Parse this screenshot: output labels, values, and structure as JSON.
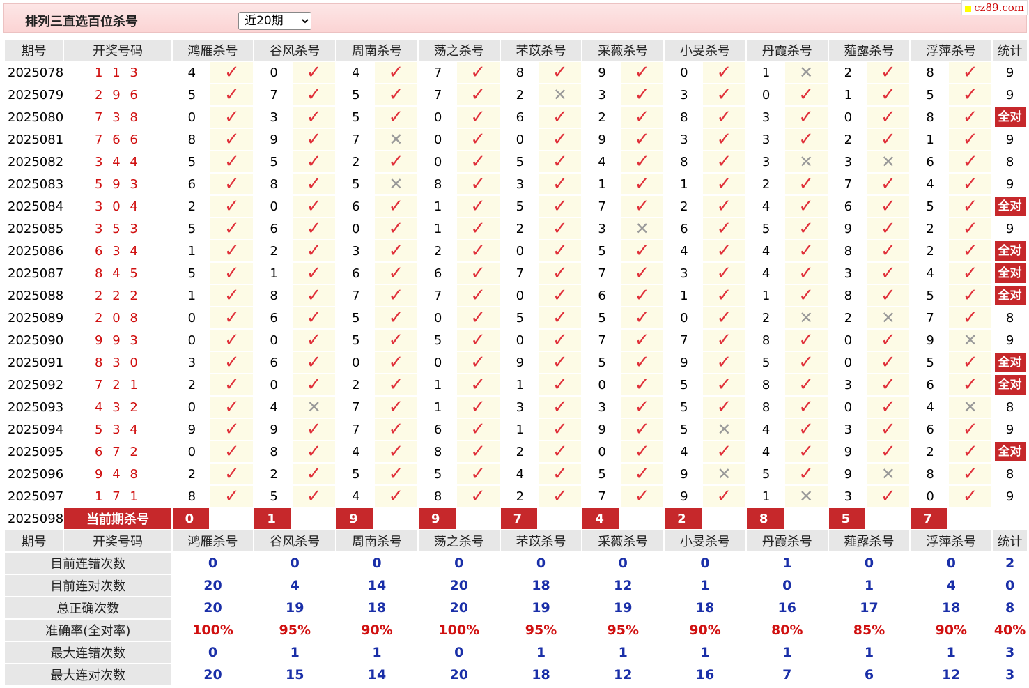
{
  "title": "排列三直选百位杀号",
  "period_select": "近20期",
  "brand": "cz89.com",
  "headers": [
    "期号",
    "开奖号码",
    "鸿雁杀号",
    "谷风杀号",
    "周南杀号",
    "荡之杀号",
    "芣苡杀号",
    "采薇杀号",
    "小旻杀号",
    "丹霞杀号",
    "薤露杀号",
    "浮萍杀号",
    "统计"
  ],
  "rows": [
    {
      "issue": "2025078",
      "win": "1 1 3",
      "kills": [
        "4",
        "0",
        "4",
        "7",
        "8",
        "9",
        "0",
        "1",
        "2",
        "8"
      ],
      "hits": [
        1,
        1,
        1,
        1,
        1,
        1,
        1,
        0,
        1,
        1
      ],
      "stat": "9"
    },
    {
      "issue": "2025079",
      "win": "2 9 6",
      "kills": [
        "5",
        "7",
        "5",
        "7",
        "2",
        "3",
        "3",
        "0",
        "1",
        "5"
      ],
      "hits": [
        1,
        1,
        1,
        1,
        0,
        1,
        1,
        1,
        1,
        1
      ],
      "stat": "9"
    },
    {
      "issue": "2025080",
      "win": "7 3 8",
      "kills": [
        "0",
        "3",
        "5",
        "0",
        "6",
        "2",
        "8",
        "3",
        "0",
        "8"
      ],
      "hits": [
        1,
        1,
        1,
        1,
        1,
        1,
        1,
        1,
        1,
        1
      ],
      "stat": "全对"
    },
    {
      "issue": "2025081",
      "win": "7 6 6",
      "kills": [
        "8",
        "9",
        "7",
        "0",
        "0",
        "9",
        "3",
        "3",
        "2",
        "1"
      ],
      "hits": [
        1,
        1,
        0,
        1,
        1,
        1,
        1,
        1,
        1,
        1
      ],
      "stat": "9"
    },
    {
      "issue": "2025082",
      "win": "3 4 4",
      "kills": [
        "5",
        "5",
        "2",
        "0",
        "5",
        "4",
        "8",
        "3",
        "3",
        "6"
      ],
      "hits": [
        1,
        1,
        1,
        1,
        1,
        1,
        1,
        0,
        0,
        1
      ],
      "stat": "8"
    },
    {
      "issue": "2025083",
      "win": "5 9 3",
      "kills": [
        "6",
        "8",
        "5",
        "8",
        "3",
        "1",
        "1",
        "2",
        "7",
        "4"
      ],
      "hits": [
        1,
        1,
        0,
        1,
        1,
        1,
        1,
        1,
        1,
        1
      ],
      "stat": "9"
    },
    {
      "issue": "2025084",
      "win": "3 0 4",
      "kills": [
        "2",
        "0",
        "6",
        "1",
        "5",
        "7",
        "2",
        "4",
        "6",
        "5"
      ],
      "hits": [
        1,
        1,
        1,
        1,
        1,
        1,
        1,
        1,
        1,
        1
      ],
      "stat": "全对"
    },
    {
      "issue": "2025085",
      "win": "3 5 3",
      "kills": [
        "5",
        "6",
        "0",
        "1",
        "2",
        "3",
        "6",
        "5",
        "9",
        "2"
      ],
      "hits": [
        1,
        1,
        1,
        1,
        1,
        0,
        1,
        1,
        1,
        1
      ],
      "stat": "9"
    },
    {
      "issue": "2025086",
      "win": "6 3 4",
      "kills": [
        "1",
        "2",
        "3",
        "2",
        "0",
        "5",
        "4",
        "4",
        "8",
        "2"
      ],
      "hits": [
        1,
        1,
        1,
        1,
        1,
        1,
        1,
        1,
        1,
        1
      ],
      "stat": "全对"
    },
    {
      "issue": "2025087",
      "win": "8 4 5",
      "kills": [
        "5",
        "1",
        "6",
        "6",
        "7",
        "7",
        "3",
        "4",
        "3",
        "4"
      ],
      "hits": [
        1,
        1,
        1,
        1,
        1,
        1,
        1,
        1,
        1,
        1
      ],
      "stat": "全对"
    },
    {
      "issue": "2025088",
      "win": "2 2 2",
      "kills": [
        "1",
        "8",
        "7",
        "7",
        "0",
        "6",
        "1",
        "1",
        "8",
        "5"
      ],
      "hits": [
        1,
        1,
        1,
        1,
        1,
        1,
        1,
        1,
        1,
        1
      ],
      "stat": "全对"
    },
    {
      "issue": "2025089",
      "win": "2 0 8",
      "kills": [
        "0",
        "6",
        "5",
        "0",
        "5",
        "5",
        "0",
        "2",
        "2",
        "7"
      ],
      "hits": [
        1,
        1,
        1,
        1,
        1,
        1,
        1,
        0,
        0,
        1
      ],
      "stat": "8"
    },
    {
      "issue": "2025090",
      "win": "9 9 3",
      "kills": [
        "0",
        "0",
        "5",
        "5",
        "0",
        "7",
        "7",
        "8",
        "0",
        "9"
      ],
      "hits": [
        1,
        1,
        1,
        1,
        1,
        1,
        1,
        1,
        1,
        0
      ],
      "stat": "9"
    },
    {
      "issue": "2025091",
      "win": "8 3 0",
      "kills": [
        "3",
        "6",
        "0",
        "0",
        "9",
        "5",
        "9",
        "5",
        "0",
        "5"
      ],
      "hits": [
        1,
        1,
        1,
        1,
        1,
        1,
        1,
        1,
        1,
        1
      ],
      "stat": "全对"
    },
    {
      "issue": "2025092",
      "win": "7 2 1",
      "kills": [
        "2",
        "0",
        "2",
        "1",
        "1",
        "0",
        "5",
        "8",
        "3",
        "6"
      ],
      "hits": [
        1,
        1,
        1,
        1,
        1,
        1,
        1,
        1,
        1,
        1
      ],
      "stat": "全对"
    },
    {
      "issue": "2025093",
      "win": "4 3 2",
      "kills": [
        "0",
        "4",
        "7",
        "1",
        "3",
        "3",
        "5",
        "8",
        "0",
        "4"
      ],
      "hits": [
        1,
        0,
        1,
        1,
        1,
        1,
        1,
        1,
        1,
        0
      ],
      "stat": "8"
    },
    {
      "issue": "2025094",
      "win": "5 3 4",
      "kills": [
        "9",
        "9",
        "7",
        "6",
        "1",
        "9",
        "5",
        "4",
        "3",
        "6"
      ],
      "hits": [
        1,
        1,
        1,
        1,
        1,
        1,
        0,
        1,
        1,
        1
      ],
      "stat": "9"
    },
    {
      "issue": "2025095",
      "win": "6 7 2",
      "kills": [
        "0",
        "8",
        "4",
        "8",
        "2",
        "0",
        "4",
        "4",
        "9",
        "2"
      ],
      "hits": [
        1,
        1,
        1,
        1,
        1,
        1,
        1,
        1,
        1,
        1
      ],
      "stat": "全对"
    },
    {
      "issue": "2025096",
      "win": "9 4 8",
      "kills": [
        "2",
        "2",
        "5",
        "5",
        "4",
        "5",
        "9",
        "5",
        "9",
        "8"
      ],
      "hits": [
        1,
        1,
        1,
        1,
        1,
        1,
        0,
        1,
        0,
        1
      ],
      "stat": "8"
    },
    {
      "issue": "2025097",
      "win": "1 7 1",
      "kills": [
        "8",
        "5",
        "4",
        "8",
        "2",
        "7",
        "9",
        "1",
        "3",
        "0"
      ],
      "hits": [
        1,
        1,
        1,
        1,
        1,
        1,
        1,
        0,
        1,
        1
      ],
      "stat": "9"
    }
  ],
  "current": {
    "issue": "2025098",
    "label": "当前期杀号",
    "kills": [
      "0",
      "1",
      "9",
      "9",
      "7",
      "4",
      "2",
      "8",
      "5",
      "7"
    ]
  },
  "summary": [
    {
      "label": "目前连错次数",
      "values": [
        "0",
        "0",
        "0",
        "0",
        "0",
        "0",
        "0",
        "1",
        "0",
        "0"
      ],
      "stat": "2",
      "rate": false
    },
    {
      "label": "目前连对次数",
      "values": [
        "20",
        "4",
        "14",
        "20",
        "18",
        "12",
        "1",
        "0",
        "1",
        "4"
      ],
      "stat": "0",
      "rate": false
    },
    {
      "label": "总正确次数",
      "values": [
        "20",
        "19",
        "18",
        "20",
        "19",
        "19",
        "18",
        "16",
        "17",
        "18"
      ],
      "stat": "8",
      "rate": false
    },
    {
      "label": "准确率(全对率)",
      "values": [
        "100%",
        "95%",
        "90%",
        "100%",
        "95%",
        "95%",
        "90%",
        "80%",
        "85%",
        "90%"
      ],
      "stat": "40%",
      "rate": true
    },
    {
      "label": "最大连错次数",
      "values": [
        "0",
        "1",
        "1",
        "0",
        "1",
        "1",
        "1",
        "1",
        "1",
        "1"
      ],
      "stat": "3",
      "rate": false
    },
    {
      "label": "最大连对次数",
      "values": [
        "20",
        "15",
        "14",
        "20",
        "18",
        "12",
        "16",
        "7",
        "6",
        "12"
      ],
      "stat": "3",
      "rate": false
    }
  ],
  "icons": {
    "hit": "check-icon",
    "miss": "cross-icon"
  },
  "colors": {
    "accent": "#c6282b",
    "hit": "#e0303a",
    "blue": "#1a2fa8"
  }
}
